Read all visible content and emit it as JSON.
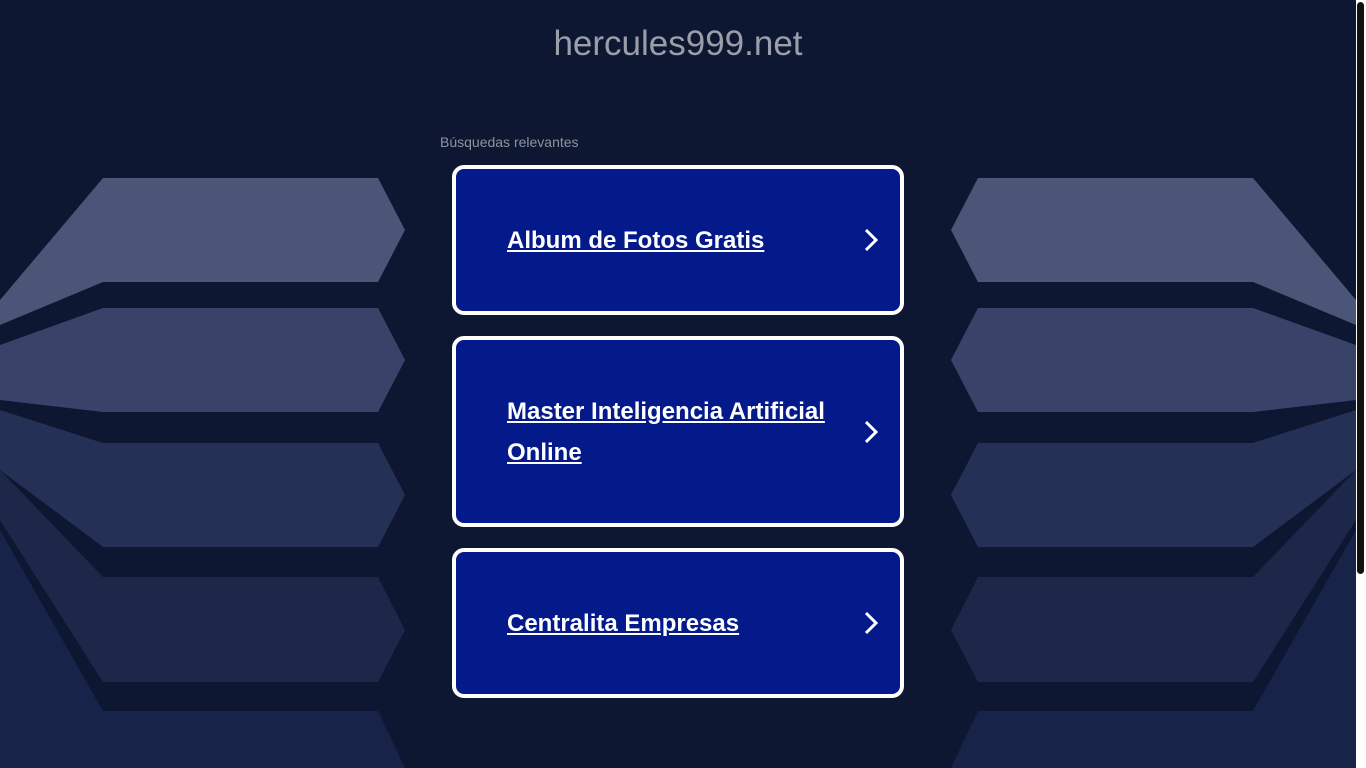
{
  "header": {
    "domain": "hercules999.net"
  },
  "main": {
    "related_label": "Búsquedas relevantes",
    "links": [
      {
        "label": "Album de Fotos Gratis",
        "icon": "chevron-right-icon"
      },
      {
        "label": "Master Inteligencia Artificial Online",
        "icon": "chevron-right-icon"
      },
      {
        "label": "Centralita Empresas",
        "icon": "chevron-right-icon"
      }
    ]
  },
  "colors": {
    "background": "#0e1731",
    "card": "#041a8b",
    "card_border": "#ffffff",
    "title_text": "#9a9ea9"
  }
}
